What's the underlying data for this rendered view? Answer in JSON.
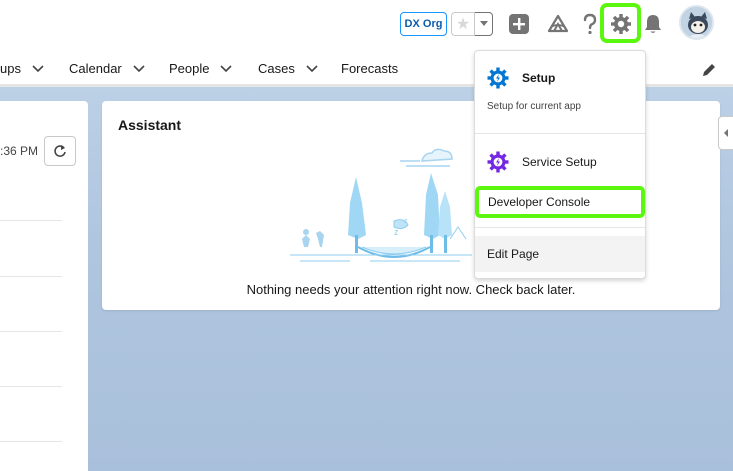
{
  "header": {
    "org_badge": "DX Org",
    "icons": [
      "star-icon",
      "chevron-down-icon",
      "add-icon",
      "trailhead-icon",
      "help-icon",
      "gear-icon",
      "bell-icon",
      "avatar"
    ]
  },
  "nav": {
    "items": [
      {
        "label": "ups",
        "has_chevron": true
      },
      {
        "label": "Calendar",
        "has_chevron": true
      },
      {
        "label": "People",
        "has_chevron": true
      },
      {
        "label": "Cases",
        "has_chevron": true
      },
      {
        "label": "Forecasts",
        "has_chevron": false
      }
    ]
  },
  "left_card": {
    "time": ":36 PM"
  },
  "assistant": {
    "title": "Assistant",
    "message": "Nothing needs your attention right now. Check back later."
  },
  "setup_menu": {
    "setup_label": "Setup",
    "setup_sub": "Setup for current app",
    "service_setup_label": "Service Setup",
    "developer_console_label": "Developer Console",
    "edit_page_label": "Edit Page"
  },
  "colors": {
    "highlight": "#5cf70e",
    "brand_blue": "#0176d3",
    "service_purple": "#7526e3",
    "page_bg": "#b0c6df"
  }
}
